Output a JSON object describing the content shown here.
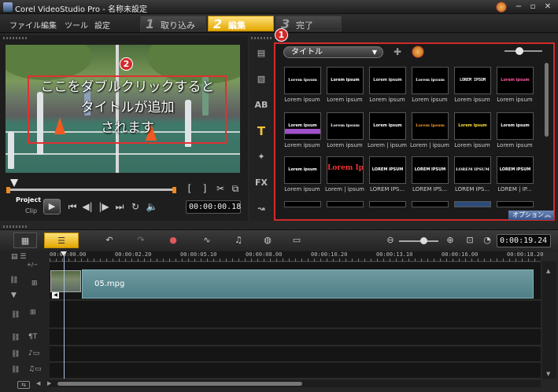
{
  "window": {
    "title": "Corel VideoStudio Pro - 名称未設定",
    "minimize": "−",
    "maximize": "▫",
    "close": "✕"
  },
  "menu": [
    "ファイル",
    "編集",
    "ツール",
    "設定"
  ],
  "steps": [
    {
      "num": "1",
      "label": "取り込み"
    },
    {
      "num": "2",
      "label": "編集"
    },
    {
      "num": "3",
      "label": "完了"
    }
  ],
  "callouts": {
    "library": "1",
    "preview": "2"
  },
  "preview": {
    "overlay_lines": [
      "ここをダブルクリックすると",
      "タイトルが追加",
      "されます"
    ],
    "project_label": "Project",
    "clip_label": "Clip",
    "timecode": "00:00:00.18",
    "trim_left": "[",
    "trim_right": "]"
  },
  "library": {
    "category": "タイトル",
    "options_label": "オプション",
    "rows": [
      [
        {
          "caption": "Lorem ipsum",
          "text": "Lorem ipsum"
        },
        {
          "caption": "Lorem ipsum",
          "text": "Lorem ipsum"
        },
        {
          "caption": "Lorem ipsum",
          "text": "Lorem ipsum"
        },
        {
          "caption": "Lorem ipsum",
          "text": "Lorem ipsum"
        },
        {
          "caption": "Lorem ipsum",
          "text": "LOREM IPSUM"
        },
        {
          "caption": "Lorem ipsum",
          "text": "Lorem ipsum"
        }
      ],
      [
        {
          "caption": "Lorem ipsum",
          "text": "Lorem ipsum"
        },
        {
          "caption": "Lorem ipsum",
          "text": "Lorem ipsum"
        },
        {
          "caption": "Lorem | ipsum",
          "text": "Lorem ipsum"
        },
        {
          "caption": "Lorem | ipsum",
          "text": "Lorem ipsum"
        },
        {
          "caption": "Lorem ipsum",
          "text": "Lorem ipsum"
        },
        {
          "caption": "Lorem ipsum",
          "text": "Lorem ipsum"
        }
      ],
      [
        {
          "caption": "Lorem ipsum",
          "text": "Lorem ipsum"
        },
        {
          "caption": "Lorem | ipsum",
          "text": "Lorem Ipsum"
        },
        {
          "caption": "LOREM IPS...",
          "text": "LOREM IPSUM"
        },
        {
          "caption": "LOREM IPS...",
          "text": "LOREM IPSUM"
        },
        {
          "caption": "LOREM IPS...",
          "text": "LOREM IPSUM"
        },
        {
          "caption": "LOREM | IP...",
          "text": "LOREM IPSUM"
        }
      ]
    ]
  },
  "timeline": {
    "timecode": "0:00:19.24",
    "ruler": [
      "00:00:00.00",
      "00:00:02.20",
      "00:00:05.10",
      "00:00:08.00",
      "00:00:10.20",
      "00:00:13.10",
      "00:00:16.00",
      "00:00:18.20"
    ],
    "clip": "05.mpg"
  }
}
